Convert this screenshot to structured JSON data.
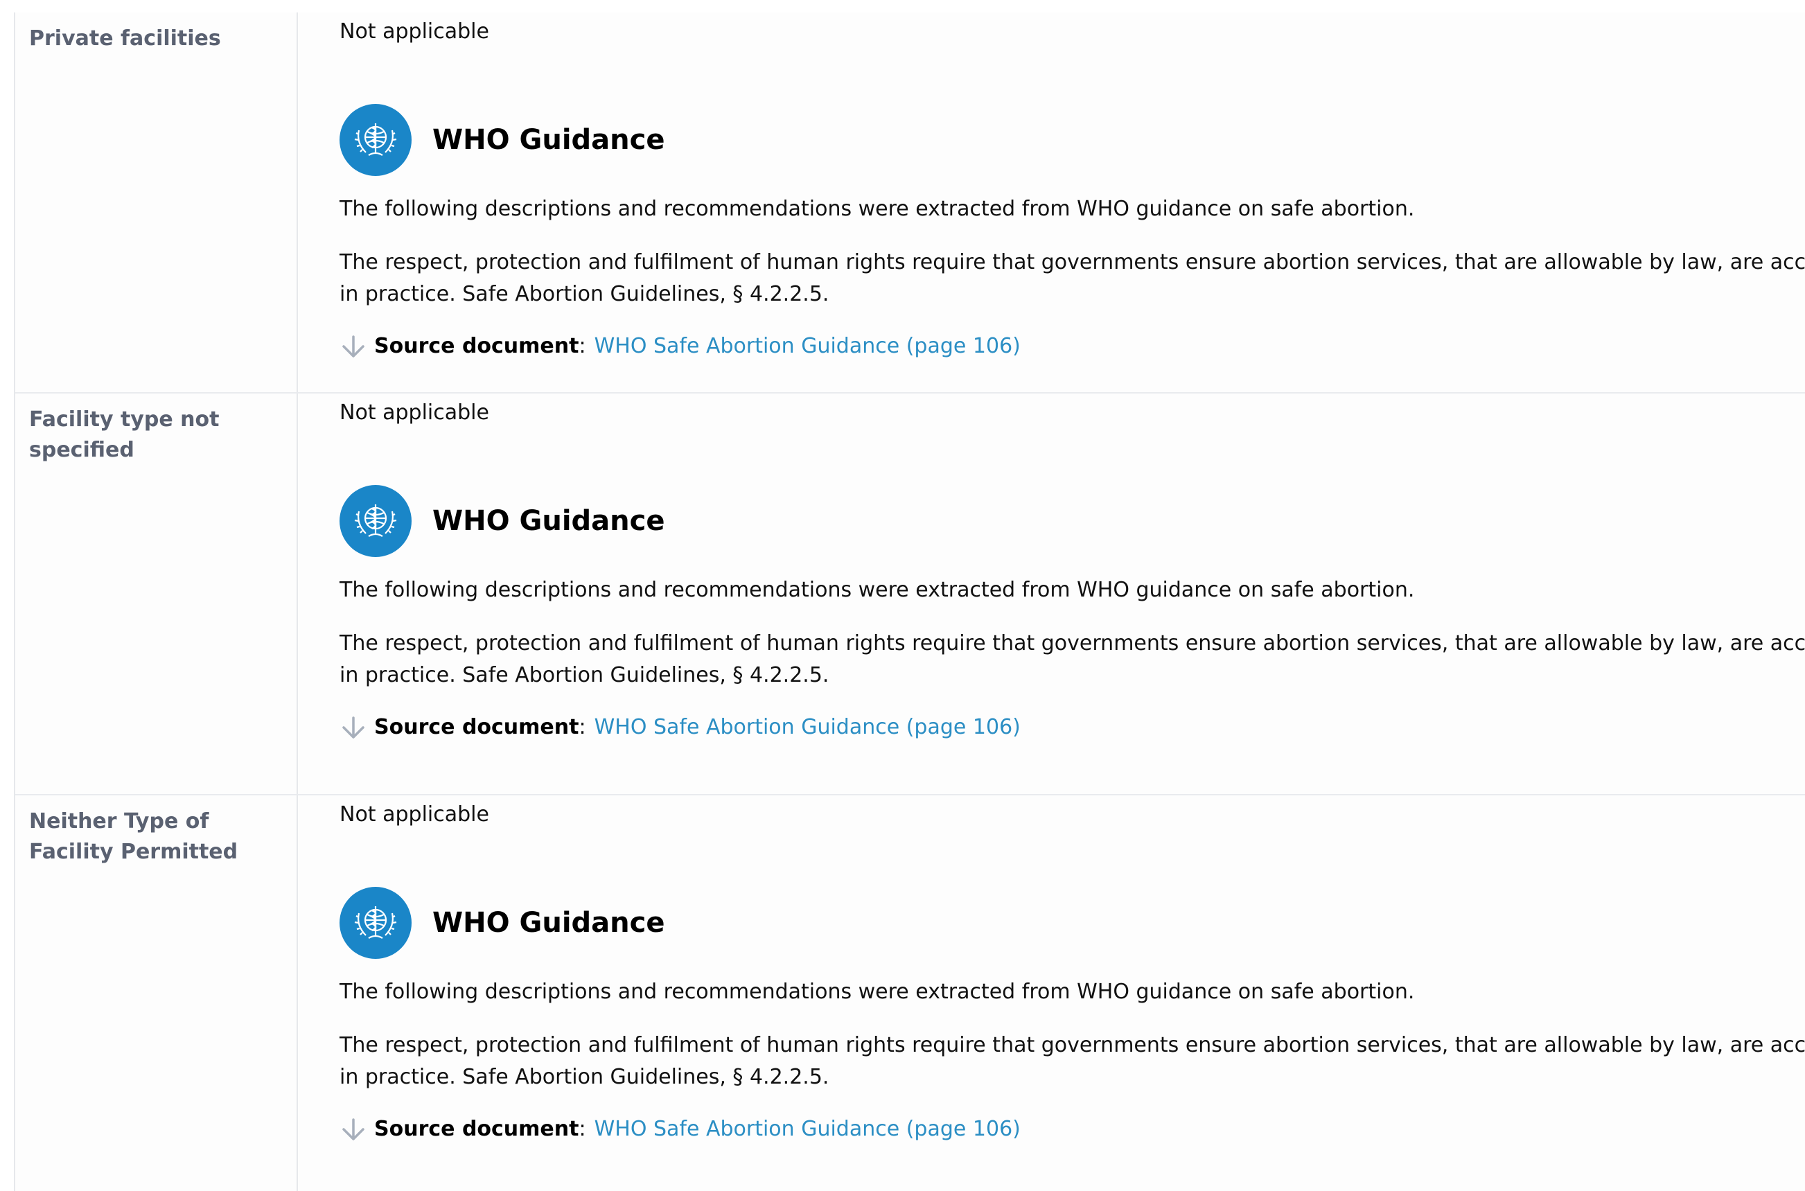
{
  "rows": [
    {
      "label": "Private facilities",
      "status": "Not applicable",
      "guidance_title": "WHO Guidance",
      "intro": "The following descriptions and recommendations were extracted from WHO guidance on safe abortion.",
      "quote": "The respect, protection and fulfilment of human rights require that governments ensure abortion services, that are allowable by law, are accessible in practice. Safe Abortion Guidelines, § 4.2.2.5.",
      "source_label": "Source document",
      "source_link": "WHO Safe Abortion Guidance (page 106)"
    },
    {
      "label": "Facility type not specified",
      "status": "Not applicable",
      "guidance_title": "WHO Guidance",
      "intro": "The following descriptions and recommendations were extracted from WHO guidance on safe abortion.",
      "quote": "The respect, protection and fulfilment of human rights require that governments ensure abortion services, that are allowable by law, are accessible in practice. Safe Abortion Guidelines, § 4.2.2.5.",
      "source_label": "Source document",
      "source_link": "WHO Safe Abortion Guidance (page 106)"
    },
    {
      "label": "Neither Type of Facility Permitted",
      "status": "Not applicable",
      "guidance_title": "WHO Guidance",
      "intro": "The following descriptions and recommendations were extracted from WHO guidance on safe abortion.",
      "quote": "The respect, protection and fulfilment of human rights require that governments ensure abortion services, that are allowable by law, are accessible in practice. Safe Abortion Guidelines, § 4.2.2.5.",
      "source_label": "Source document",
      "source_link": "WHO Safe Abortion Guidance (page 106)"
    }
  ],
  "icons": {
    "logo": "who-emblem-icon",
    "source": "arrow-down-icon"
  },
  "colors": {
    "label_text": "#5a6171",
    "link": "#2b8ec4",
    "who_blue": "#1a86c8",
    "divider": "#e6e8eb"
  }
}
